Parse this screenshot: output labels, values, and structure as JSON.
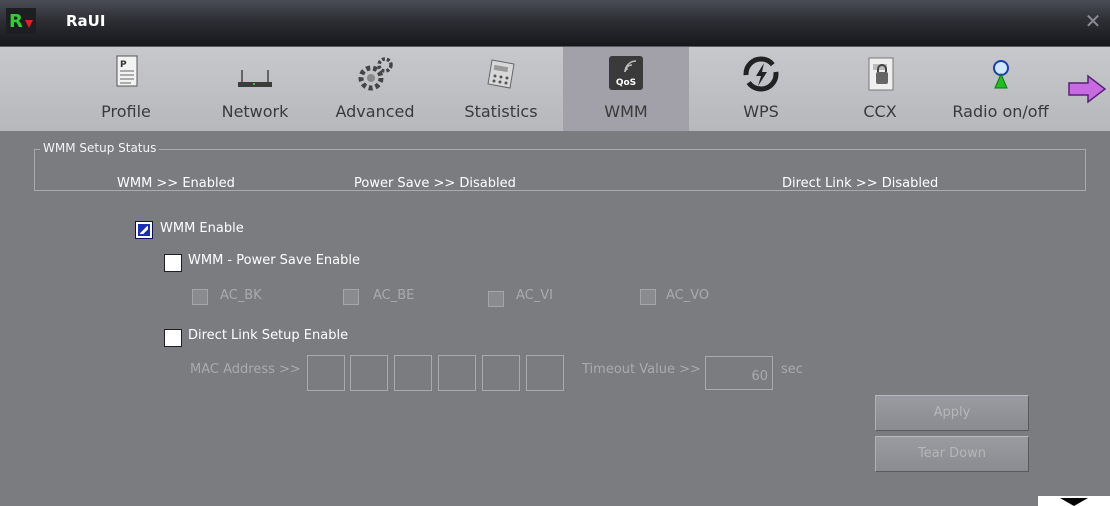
{
  "window": {
    "title": "RaUI",
    "close_icon": "close-icon"
  },
  "toolbar": {
    "items": [
      {
        "label": "Profile",
        "icon": "profile-icon"
      },
      {
        "label": "Network",
        "icon": "network-icon"
      },
      {
        "label": "Advanced",
        "icon": "advanced-gear-icon"
      },
      {
        "label": "Statistics",
        "icon": "statistics-icon"
      },
      {
        "label": "WMM",
        "icon": "qos-icon",
        "selected": true
      },
      {
        "label": "WPS",
        "icon": "wps-icon"
      },
      {
        "label": "CCX",
        "icon": "ccx-icon"
      },
      {
        "label": "Radio on/off",
        "icon": "radio-icon"
      }
    ],
    "next_icon": "arrow-right-icon"
  },
  "status": {
    "legend": "WMM Setup Status",
    "wmm": "WMM >> Enabled",
    "power_save": "Power Save >> Disabled",
    "direct_link": "Direct Link >> Disabled"
  },
  "wmm_enable": {
    "label": "WMM Enable",
    "checked": true
  },
  "power_save_enable": {
    "label": "WMM - Power Save Enable",
    "checked": false
  },
  "ac": {
    "bk": "AC_BK",
    "be": "AC_BE",
    "vi": "AC_VI",
    "vo": "AC_VO"
  },
  "direct_link_enable": {
    "label": "Direct Link Setup Enable",
    "checked": false
  },
  "mac": {
    "label": "MAC Address >>",
    "octets": [
      "",
      "",
      "",
      "",
      "",
      ""
    ]
  },
  "timeout": {
    "label": "Timeout Value >>",
    "value": "60",
    "unit": "sec"
  },
  "buttons": {
    "apply": "Apply",
    "tear_down": "Tear Down"
  },
  "colors": {
    "accent_checked": "#1a2fb4",
    "panel_bg": "#7b7c80",
    "toolbar_selected": "#a2a0a8"
  }
}
